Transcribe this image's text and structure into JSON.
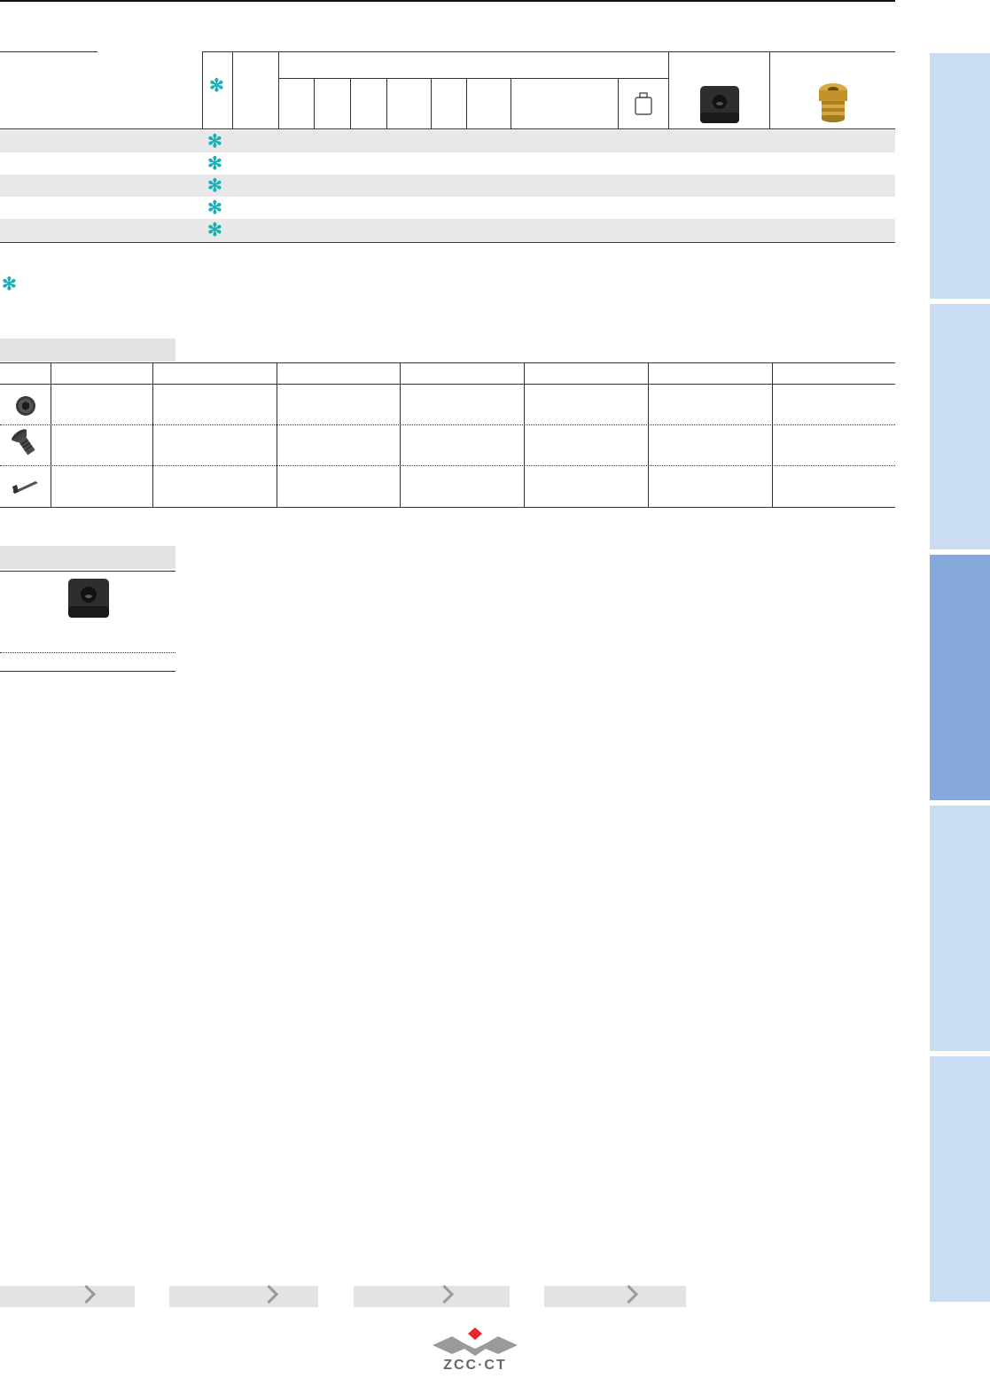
{
  "legend": {
    "symbol": "✻"
  },
  "main_table": {
    "row_count": 5,
    "rows": [
      {
        "symbol": "✻"
      },
      {
        "symbol": "✻"
      },
      {
        "symbol": "✻"
      },
      {
        "symbol": "✻"
      },
      {
        "symbol": "✻"
      }
    ]
  },
  "spare_parts": {
    "icons": [
      "set-screw-icon",
      "torx-screw-icon",
      "key-wrench-icon"
    ]
  },
  "insert_section": {
    "icon": "square-insert-icon"
  },
  "header_icons": [
    "weight-icon",
    "square-insert-icon",
    "brass-coolant-nozzle-icon"
  ],
  "footer": {
    "nav_buttons": 4,
    "logo": "ZCC·CT"
  },
  "colors": {
    "accent": "#1ab0b8",
    "side_tab": "#c9dcf2",
    "side_tab_active": "#86a9dc",
    "row_shade": "#e8e8e8",
    "logo_red": "#e8262a"
  }
}
